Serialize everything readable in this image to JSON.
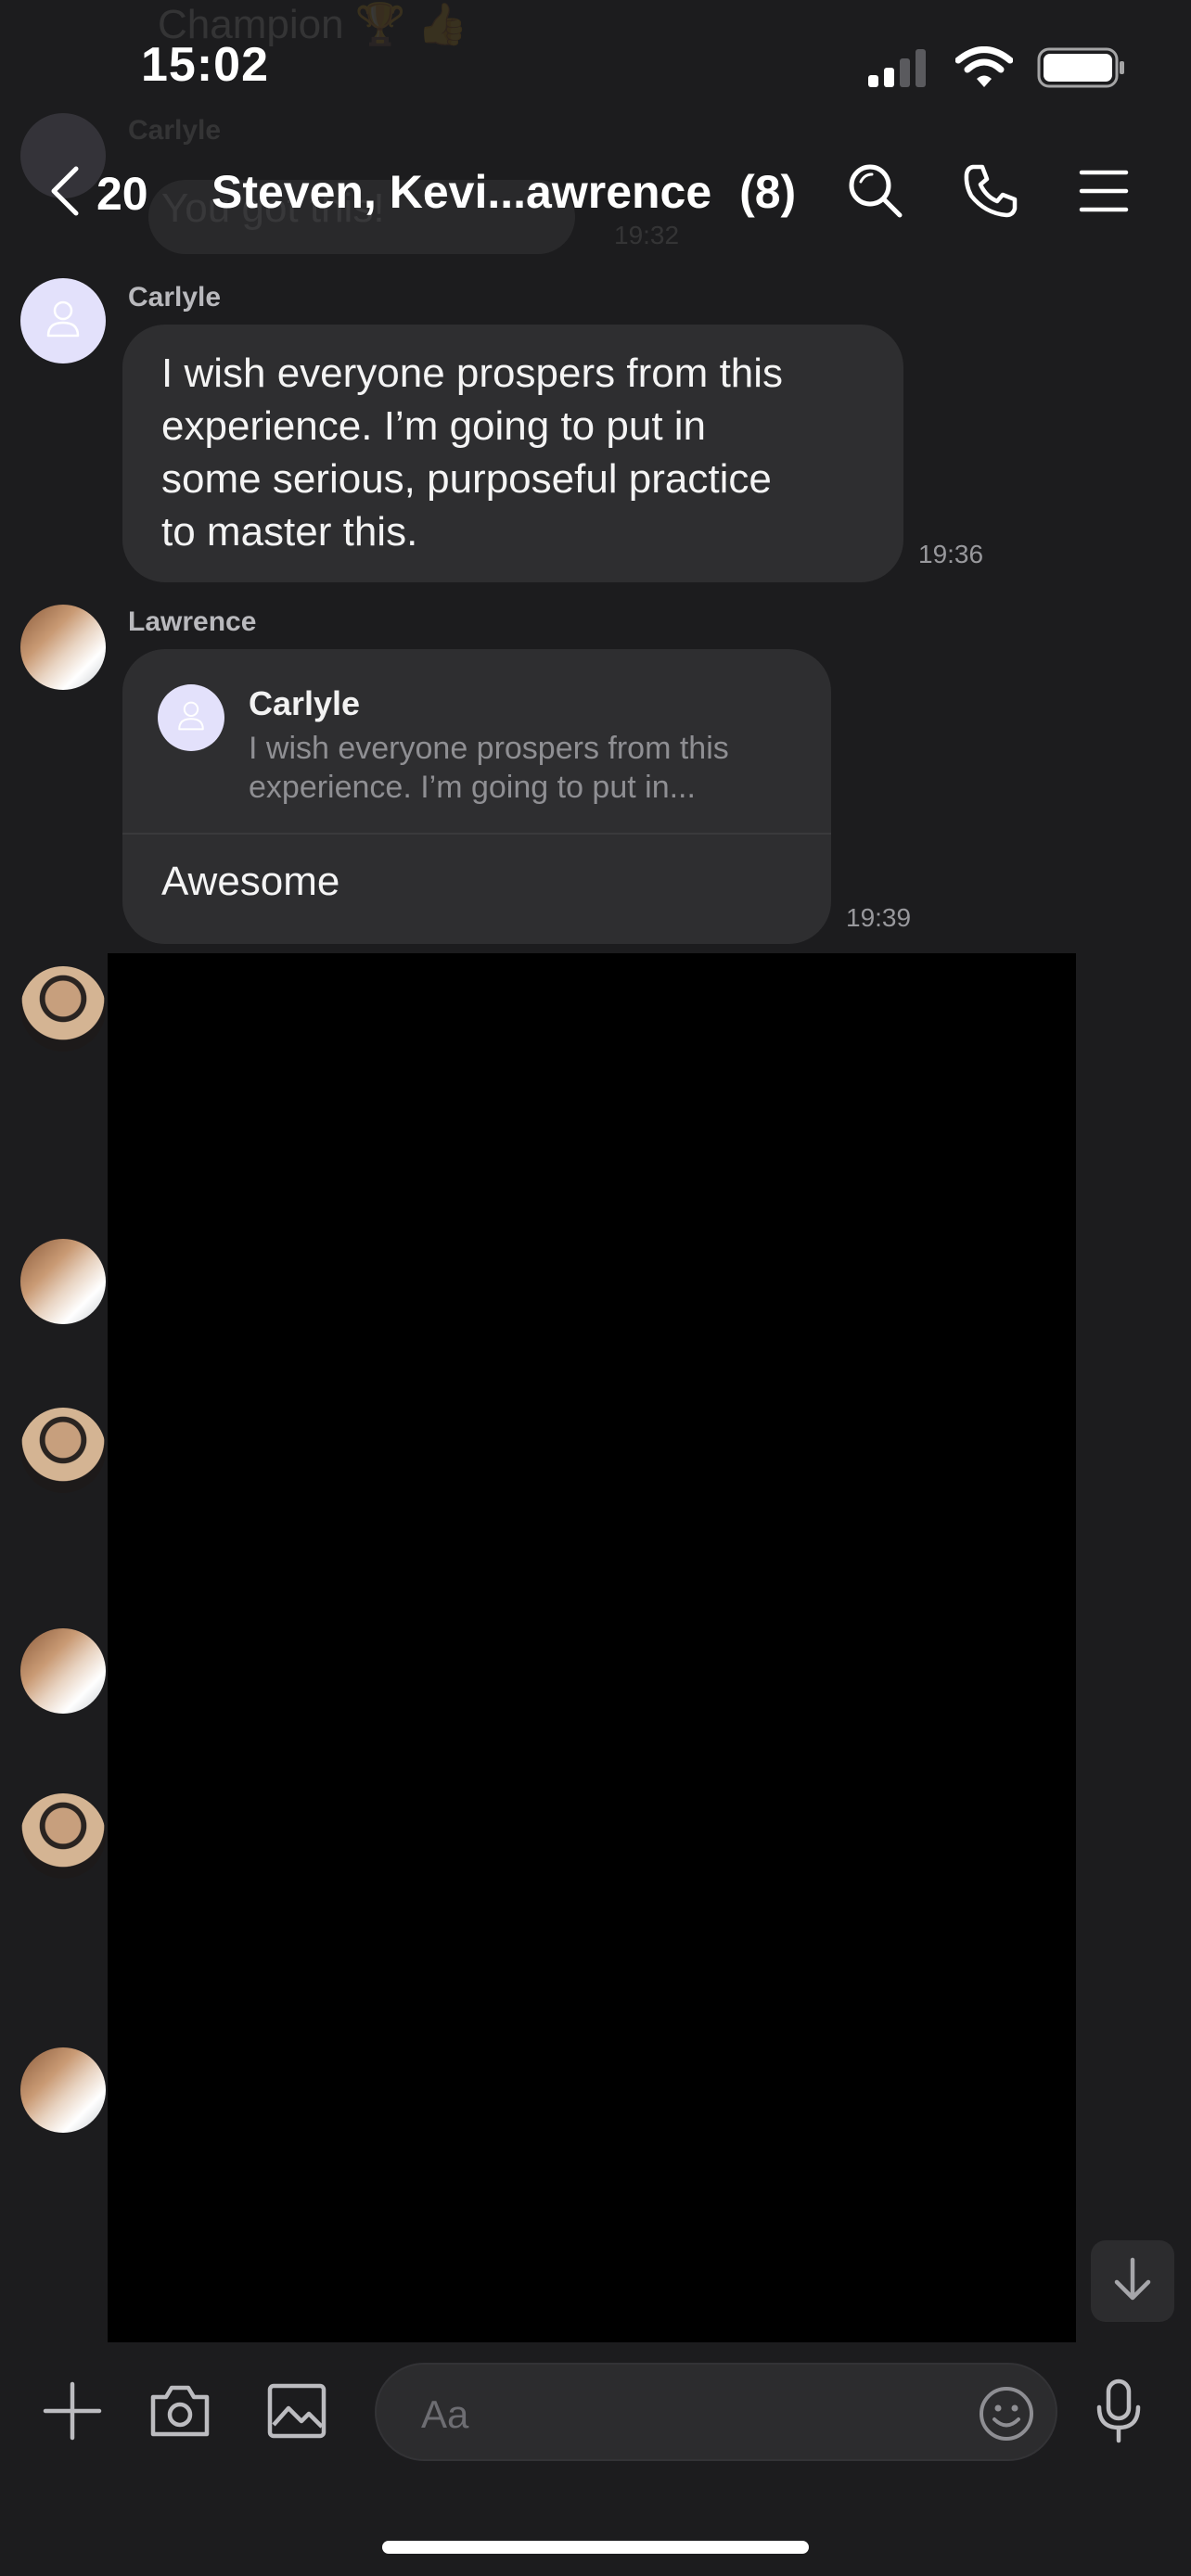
{
  "status_bar": {
    "time": "15:02",
    "icons": [
      "signal-icon",
      "wifi-icon",
      "battery-icon"
    ]
  },
  "background_previous": {
    "message_text": "Champion 🏆 👍",
    "sender": "Carlyle",
    "partial_text": "You got this!",
    "time": "19:32"
  },
  "nav": {
    "back_count": "20",
    "title": "Steven, Kevi...awrence",
    "member_count": "(8)",
    "icons": [
      "search-icon",
      "phone-icon",
      "menu-icon"
    ]
  },
  "messages": [
    {
      "sender": "Carlyle",
      "avatar": "default-avatar",
      "lines": [
        "I wish everyone prospers from this",
        "experience. I’m going to put in",
        "some serious, purposeful practice",
        "to master this."
      ],
      "time": "19:36"
    },
    {
      "sender": "Lawrence",
      "avatar": "couple-photo",
      "quote": {
        "name": "Carlyle",
        "lines": [
          "I wish everyone prospers from this",
          "experience. I’m going to put in..."
        ]
      },
      "text": "Awesome",
      "time": "19:39"
    }
  ],
  "side_avatars": [
    "man-photo",
    "couple-photo",
    "man-photo",
    "couple-photo",
    "man-photo",
    "couple-photo"
  ],
  "composer": {
    "placeholder": "Aa",
    "icons": [
      "plus-icon",
      "camera-icon",
      "image-icon",
      "emoji-icon",
      "microphone-icon"
    ]
  },
  "colors": {
    "background": "#1c1c1e",
    "bubble": "#2e2e30",
    "accent_avatar": "#e3e1fb",
    "media": "#000000"
  }
}
